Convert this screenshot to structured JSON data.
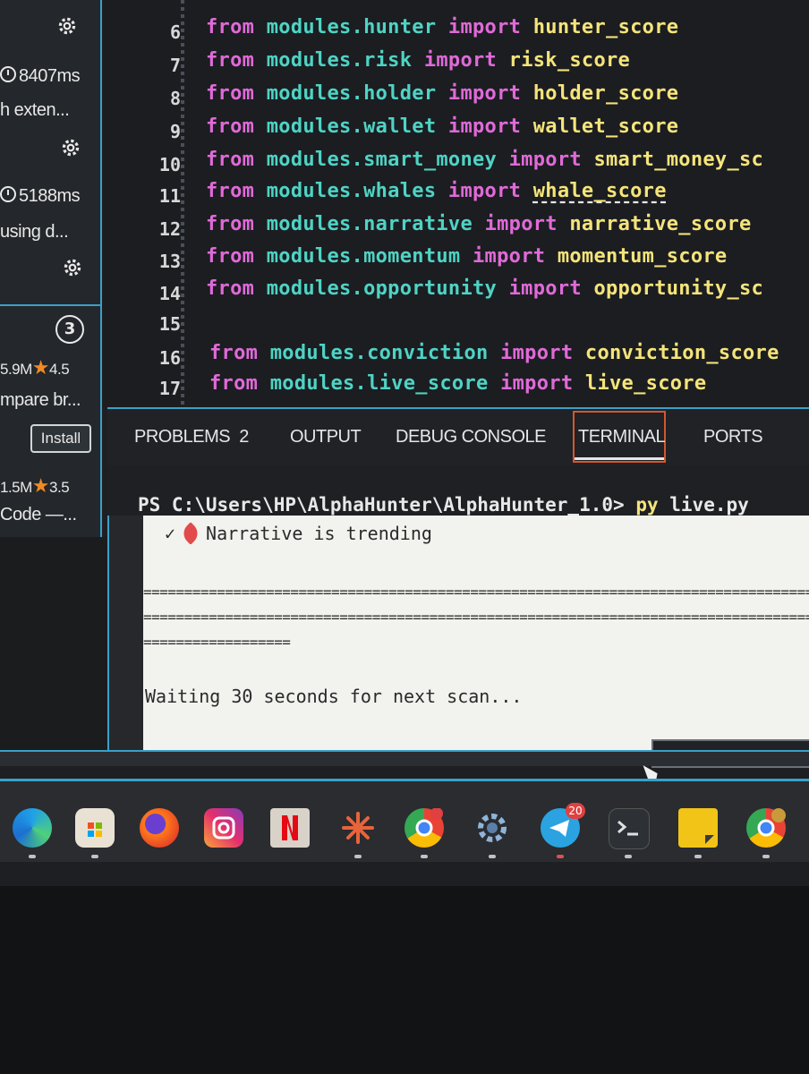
{
  "sidebar": {
    "extensions": [
      {
        "time": "8407ms",
        "desc": "h exten..."
      },
      {
        "time": "5188ms",
        "desc": "using d..."
      }
    ],
    "badge": "3",
    "marketplace": [
      {
        "downloads": "5.9M",
        "rating": "4.5",
        "desc": "mpare br...",
        "install_label": "Install"
      },
      {
        "downloads": "1.5M",
        "rating": "3.5",
        "desc": "Code —..."
      }
    ]
  },
  "editor": {
    "lines": [
      {
        "n": "6",
        "module": "modules.hunter",
        "name": "hunter_score"
      },
      {
        "n": "7",
        "module": "modules.risk",
        "name": "risk_score"
      },
      {
        "n": "8",
        "module": "modules.holder",
        "name": "holder_score"
      },
      {
        "n": "9",
        "module": "modules.wallet",
        "name": "wallet_score"
      },
      {
        "n": "10",
        "module": "modules.smart_money",
        "name": "smart_money_sc"
      },
      {
        "n": "11",
        "module": "modules.whales",
        "name": "whale_score"
      },
      {
        "n": "12",
        "module": "modules.narrative",
        "name": "narrative_score"
      },
      {
        "n": "13",
        "module": "modules.momentum",
        "name": "momentum_score"
      },
      {
        "n": "14",
        "module": "modules.opportunity",
        "name": "opportunity_sc"
      },
      {
        "n": "15",
        "module": "",
        "name": ""
      },
      {
        "n": "16",
        "module": "modules.conviction",
        "name": "conviction_score"
      },
      {
        "n": "17",
        "module": "modules.live_score",
        "name": "live_score"
      }
    ],
    "kw_from": "from",
    "kw_import": "import"
  },
  "panel": {
    "tabs": [
      {
        "label": "PROBLEMS",
        "count": "2"
      },
      {
        "label": "OUTPUT"
      },
      {
        "label": "DEBUG CONSOLE"
      },
      {
        "label": "TERMINAL"
      },
      {
        "label": "PORTS"
      }
    ],
    "active_tab": "TERMINAL"
  },
  "terminal": {
    "prompt": "PS C:\\Users\\HP\\AlphaHunter\\AlphaHunter_1.0>",
    "command": "py",
    "arg": "live.py",
    "check_line": "Narrative is trending",
    "rule_long": "================================================================================================",
    "rule_short": "==================",
    "waiting": "Waiting 30 seconds for next scan..."
  },
  "taskbar": {
    "icons": [
      "edge-icon",
      "store-icon",
      "firefox-icon",
      "instagram-icon",
      "netflix-icon",
      "claude-icon",
      "chrome-icon",
      "settings-icon",
      "telegram-icon",
      "terminal-icon",
      "sticky-notes-icon",
      "chrome-profile-icon"
    ],
    "telegram_badge": "20"
  },
  "colors": {
    "keyword": "#e06ad8",
    "module": "#4fd3c4",
    "function": "#f5e47a",
    "accent": "#3aa0c8",
    "active_tab_border": "#d2572e"
  }
}
